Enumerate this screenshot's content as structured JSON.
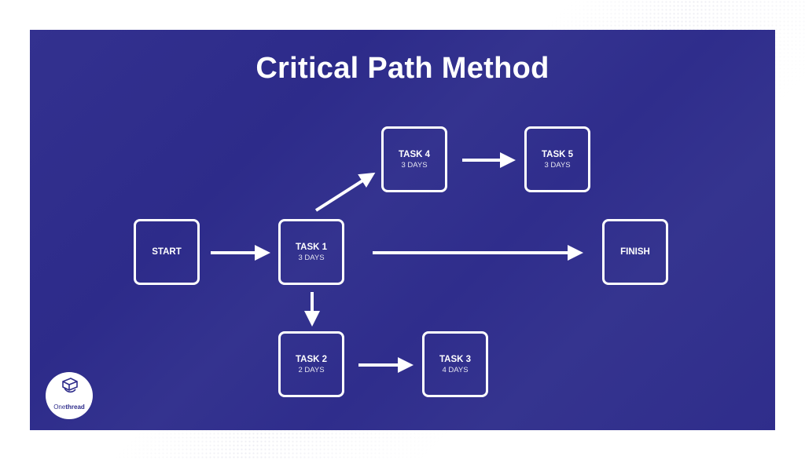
{
  "title": "Critical Path Method",
  "nodes": [
    {
      "id": "start",
      "label": "START",
      "duration": ""
    },
    {
      "id": "task1",
      "label": "TASK 1",
      "duration": "3 DAYS"
    },
    {
      "id": "task2",
      "label": "TASK 2",
      "duration": "2 DAYS"
    },
    {
      "id": "task3",
      "label": "TASK 3",
      "duration": "4 DAYS"
    },
    {
      "id": "task4",
      "label": "TASK 4",
      "duration": "3 DAYS"
    },
    {
      "id": "task5",
      "label": "TASK 5",
      "duration": "3 DAYS"
    },
    {
      "id": "finish",
      "label": "FINISH",
      "duration": ""
    }
  ],
  "edges": [
    {
      "from": "start",
      "to": "task1"
    },
    {
      "from": "task1",
      "to": "task4"
    },
    {
      "from": "task4",
      "to": "task5"
    },
    {
      "from": "task1",
      "to": "finish"
    },
    {
      "from": "task1",
      "to": "task2"
    },
    {
      "from": "task2",
      "to": "task3"
    }
  ],
  "logo": {
    "icon": "onethread-logo-icon",
    "brand_light": "One",
    "brand_bold": "thread"
  },
  "colors": {
    "panel": "#2f2d8c",
    "foreground": "#ffffff"
  }
}
